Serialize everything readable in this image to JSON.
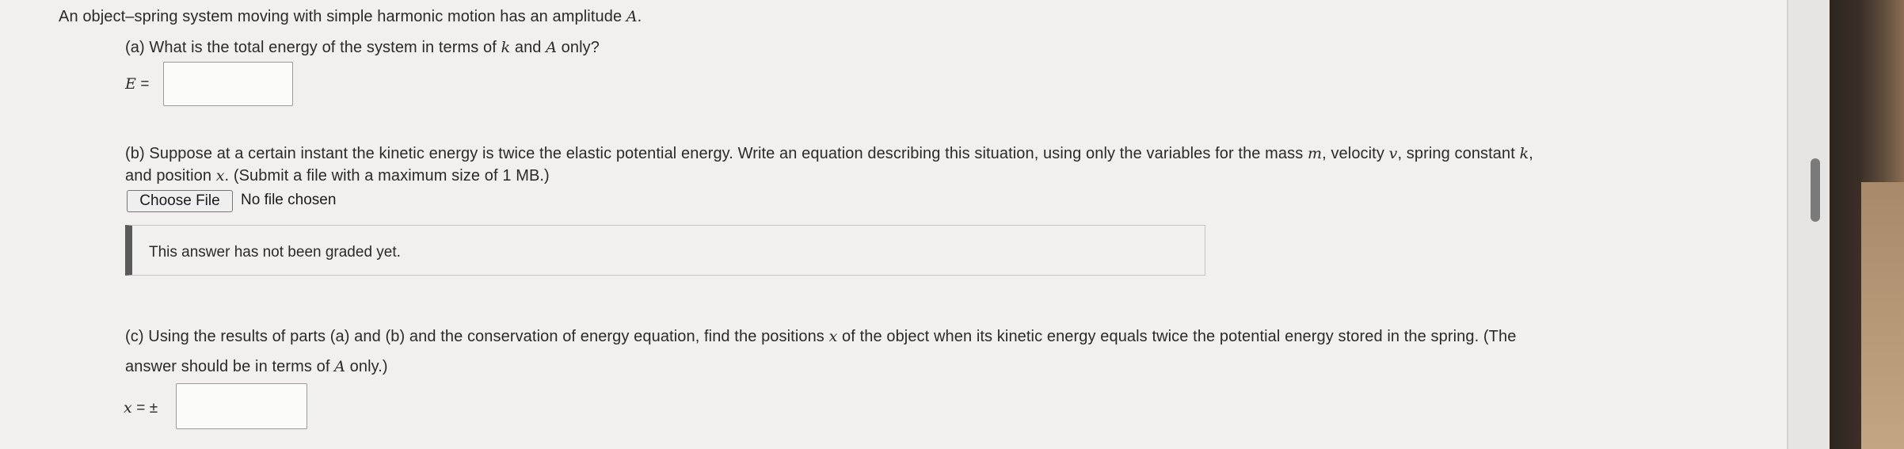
{
  "intro": {
    "pre": "An object–spring system moving with simple harmonic motion has an amplitude ",
    "var": "A",
    "post": "."
  },
  "part_a": {
    "q_pre": "(a) What is the total energy of the system in terms of ",
    "v1": "k",
    "mid": " and ",
    "v2": "A",
    "q_post": " only?",
    "label_var": "E",
    "label_eq": " ="
  },
  "part_b": {
    "l1": "(b) Suppose at a certain instant the kinetic energy is twice the elastic potential energy. Write an equation describing this situation, using only the variables for the mass ",
    "vm": "m",
    "l1b": ", velocity ",
    "vv": "v",
    "l1c": ", spring constant ",
    "vk": "k",
    "l1d": ",",
    "l2a": "and position ",
    "vx": "x",
    "l2b": ". (Submit a file with a maximum size of 1 MB.)",
    "file_button": "Choose File",
    "file_status": "No file chosen",
    "grade_status": "This answer has not been graded yet."
  },
  "part_c": {
    "l1a": "(c) Using the results of parts (a) and (b) and the conservation of energy equation, find the positions ",
    "vx": "x",
    "l1b": " of the object when its kinetic energy equals twice the potential energy stored in the spring. (The",
    "l2a": "answer should be in terms of ",
    "vA": "A",
    "l2b": " only.)",
    "label_var": "x",
    "label_eq": " = ±"
  }
}
